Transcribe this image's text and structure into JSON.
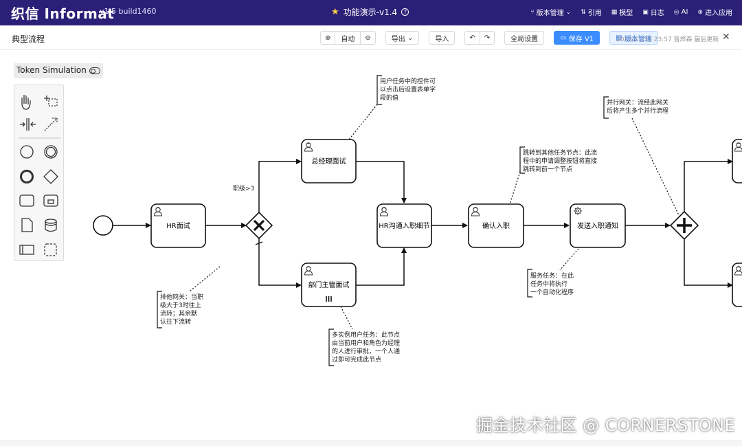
{
  "topbar": {
    "logo": "织信 Informat",
    "version": "v1.5 build1460",
    "title": "功能演示-v1.4",
    "nav": [
      {
        "label": "版本管理",
        "icon": "branch-icon"
      },
      {
        "label": "引用",
        "icon": "reference-icon"
      },
      {
        "label": "模型",
        "icon": "model-icon"
      },
      {
        "label": "日志",
        "icon": "log-icon"
      },
      {
        "label": "AI",
        "icon": "ai-icon"
      },
      {
        "label": "进入应用",
        "icon": "enter-icon"
      }
    ]
  },
  "subbar": {
    "page_title": "典型流程",
    "zoom_auto": "自动",
    "export": "导出",
    "import": "导入",
    "global_settings": "全局设置",
    "save": "保存 V1",
    "version_mgmt": "版本管理",
    "save_info": "2023/11/30 23:57 曾烨森 最后更新"
  },
  "token_simulation": "Token Simulation",
  "diagram": {
    "tasks": {
      "hr_interview": "HR面试",
      "gm_interview": "总经理面试",
      "dept_interview": "部门主管面试",
      "hr_details": "HR沟通入职细节",
      "confirm": "确认入职",
      "notify": "发送入职通知"
    },
    "condition_label": "职级>3",
    "annotations": {
      "user_task": [
        "用户任务中的控件可",
        "以点击后设置表单字",
        "段的值"
      ],
      "exclusive": [
        "排他网关：当职",
        "级大于3时往上",
        "流转；其余默",
        "认往下流转"
      ],
      "multi": [
        "多实例用户任务：此节点",
        "由当前用户和角色为经理",
        "的人进行审批，一个人通",
        "过即可完成此节点"
      ],
      "jump": [
        "跳转到其他任务节点：此流",
        "程中的申请调整按钮将直接",
        "跳转到前一个节点"
      ],
      "service": [
        "服务任务：在此",
        "任务中将执行",
        "一个自动化程序"
      ],
      "parallel": [
        "并行网关：流经此网关",
        "后将产生多个并行流程"
      ]
    }
  },
  "watermark": "掘金技术社区 @ CORNERSTONE"
}
